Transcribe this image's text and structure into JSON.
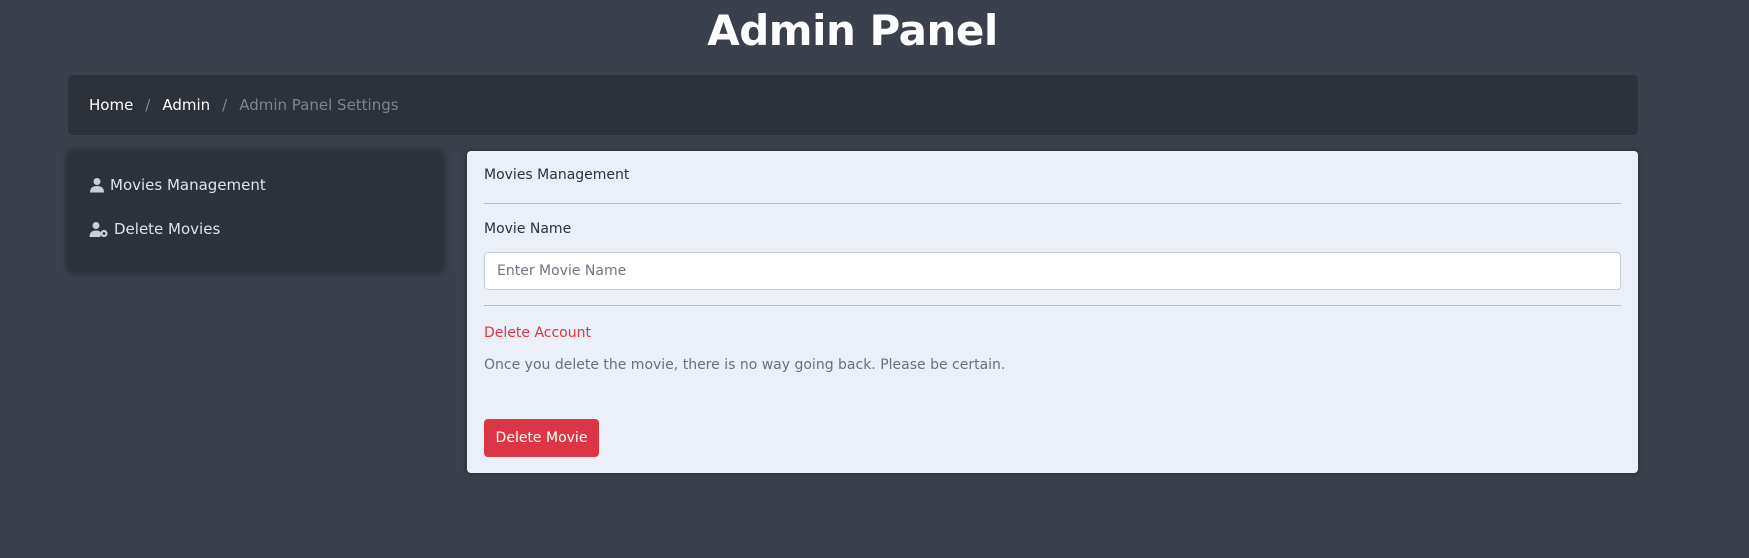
{
  "header": {
    "title": "Admin Panel"
  },
  "breadcrumb": {
    "items": [
      "Home",
      "Admin"
    ],
    "separator": "/",
    "current": "Admin Panel Settings"
  },
  "sidebar": {
    "items": [
      {
        "label": "Movies Management",
        "icon": "user-icon"
      },
      {
        "label": "Delete Movies",
        "icon": "user-gear-icon"
      }
    ]
  },
  "panel": {
    "title": "Movies Management",
    "movie_name_label": "Movie Name",
    "movie_name_placeholder": "Enter Movie Name",
    "movie_name_value": "",
    "danger_title": "Delete Account",
    "danger_text": "Once you delete the movie, there is no way going back. Please be certain.",
    "delete_button": "Delete Movie"
  },
  "colors": {
    "background": "#3a404c",
    "card_dark": "#2c313a",
    "panel": "#eaeff8",
    "danger": "#dc3545"
  }
}
